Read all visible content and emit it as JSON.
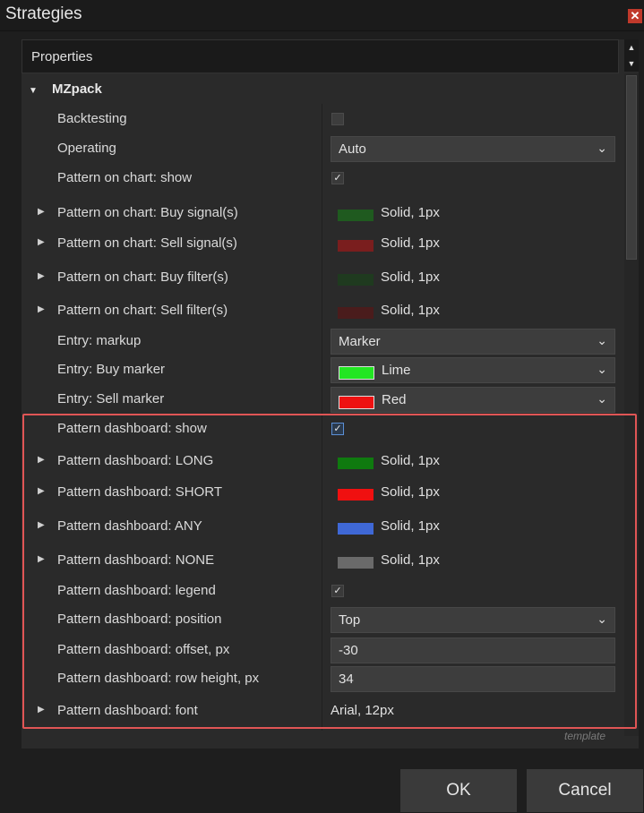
{
  "window": {
    "title": "Strategies",
    "close_icon": "close-icon"
  },
  "properties": {
    "header": "Properties"
  },
  "group": {
    "name": "MZpack"
  },
  "rows": {
    "backtesting": {
      "label": "Backtesting",
      "checked": false
    },
    "operating": {
      "label": "Operating",
      "value": "Auto"
    },
    "pattern_chart_show": {
      "label": "Pattern on chart: show",
      "checked": true
    },
    "buy_signals": {
      "label": "Pattern on chart: Buy signal(s)",
      "value": "Solid, 1px",
      "color": "#1f5a1f"
    },
    "sell_signals": {
      "label": "Pattern on chart: Sell signal(s)",
      "value": "Solid, 1px",
      "color": "#7a1e1e"
    },
    "buy_filters": {
      "label": "Pattern on chart: Buy filter(s)",
      "value": "Solid, 1px",
      "color": "#1f3a1f"
    },
    "sell_filters": {
      "label": "Pattern on chart: Sell filter(s)",
      "value": "Solid, 1px",
      "color": "#4a1c1c"
    },
    "entry_markup": {
      "label": "Entry: markup",
      "value": "Marker"
    },
    "entry_buy_marker": {
      "label": "Entry: Buy marker",
      "value": "Lime",
      "color": "#22e622"
    },
    "entry_sell_marker": {
      "label": "Entry: Sell marker",
      "value": "Red",
      "color": "#ee1111"
    },
    "dash_show": {
      "label": "Pattern dashboard: show",
      "checked": true
    },
    "dash_long": {
      "label": "Pattern dashboard: LONG",
      "value": "Solid, 1px",
      "color": "#0f7a0f"
    },
    "dash_short": {
      "label": "Pattern dashboard: SHORT",
      "value": "Solid, 1px",
      "color": "#f01010"
    },
    "dash_any": {
      "label": "Pattern dashboard: ANY",
      "value": "Solid, 1px",
      "color": "#3f68d6"
    },
    "dash_none": {
      "label": "Pattern dashboard: NONE",
      "value": "Solid, 1px",
      "color": "#6a6a6a"
    },
    "dash_legend": {
      "label": "Pattern dashboard: legend",
      "checked": true
    },
    "dash_position": {
      "label": "Pattern dashboard: position",
      "value": "Top"
    },
    "dash_offset": {
      "label": "Pattern dashboard: offset, px",
      "value": "-30"
    },
    "dash_row_height": {
      "label": "Pattern dashboard: row height, px",
      "value": "34"
    },
    "dash_font": {
      "label": "Pattern dashboard: font",
      "value": "Arial, 12px"
    }
  },
  "template_link": "template",
  "buttons": {
    "ok": "OK",
    "cancel": "Cancel"
  },
  "highlight_color": "#e05555"
}
